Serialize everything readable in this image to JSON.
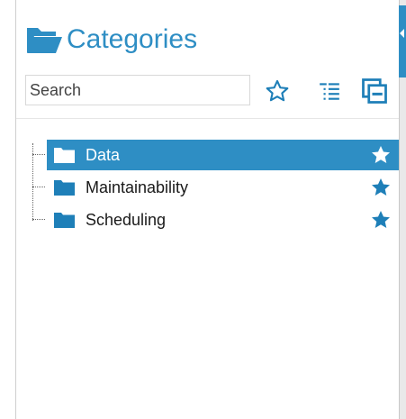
{
  "panel": {
    "title": "Categories",
    "title_icon": "folder-open-icon",
    "accent_color": "#2e8ec4"
  },
  "search": {
    "value": "",
    "placeholder": "Search"
  },
  "toolbar": {
    "buttons": [
      {
        "name": "favorites",
        "icon": "star-outline-icon"
      },
      {
        "name": "expand-all",
        "icon": "list-tree-icon"
      },
      {
        "name": "collapse-all",
        "icon": "collapse-all-icon"
      }
    ]
  },
  "tree": {
    "items": [
      {
        "label": "Data",
        "icon": "folder-icon",
        "favorite": true,
        "selected": true
      },
      {
        "label": "Maintainability",
        "icon": "folder-icon",
        "favorite": true,
        "selected": false
      },
      {
        "label": "Scheduling",
        "icon": "folder-icon",
        "favorite": true,
        "selected": false
      }
    ]
  },
  "colors": {
    "selected_row": "#2e8ec4",
    "selected_text": "#ffffff",
    "icon": "#1e7fb8"
  }
}
